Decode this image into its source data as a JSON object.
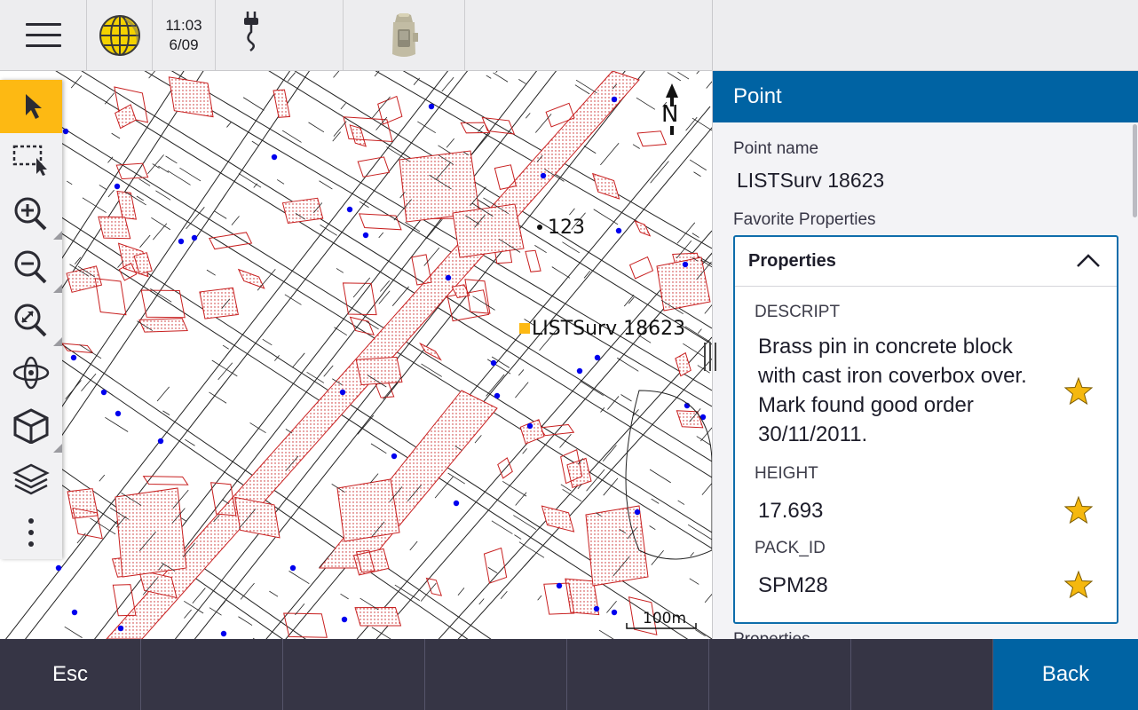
{
  "status_bar": {
    "time": "11:03",
    "date": "6/09",
    "icons": [
      "menu-icon",
      "globe-icon",
      "power-plug-icon",
      "gnss-receiver-icon"
    ]
  },
  "map": {
    "selected_point_label": "LISTSurv 18623",
    "point_label_123": "123",
    "north_label": "N",
    "scale_label": "100m",
    "colors": {
      "parcel_fill": "#e04040",
      "control_point": "#0000ee",
      "selected_point": "#fdb913"
    }
  },
  "toolbar": {
    "tools": [
      "select-icon",
      "select-box-icon",
      "zoom-in-icon",
      "zoom-out-icon",
      "zoom-extents-icon",
      "orbit-icon",
      "3d-view-icon",
      "layers-icon",
      "more-icon"
    ],
    "active_tool": "select-icon",
    "accent": "#fdb913"
  },
  "panel": {
    "title": "Point",
    "point_name_label": "Point name",
    "point_name_value": "LISTSurv 18623",
    "favorite_label": "Favorite Properties",
    "properties_header": "Properties",
    "properties": [
      {
        "key": "DESCRIPT",
        "value": "Brass pin in concrete block with cast iron coverbox over. Mark found good order 30/11/2011."
      },
      {
        "key": "HEIGHT",
        "value": "17.693"
      },
      {
        "key": "PACK_ID",
        "value": "SPM28"
      }
    ],
    "more_label": "Properties",
    "header_color": "#0063a3",
    "star_color": "#f5b80f"
  },
  "bottom_bar": {
    "esc_label": "Esc",
    "back_label": "Back"
  }
}
